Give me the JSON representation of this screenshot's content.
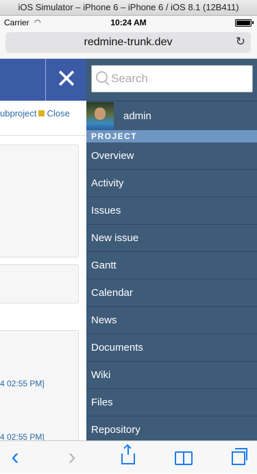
{
  "simulator": {
    "title": "iOS Simulator – iPhone 6 – iPhone 6 / iOS 8.1 (12B411)"
  },
  "status_bar": {
    "carrier": "Carrier",
    "time": "10:24 AM"
  },
  "browser": {
    "url": "redmine-trunk.dev",
    "reload_icon": "reload-icon"
  },
  "page": {
    "close_glyph": "✕",
    "actions_text": "ubproject",
    "close_label": "Close",
    "timestamps": [
      "4 02:55 PM]",
      "4 02:55 PM]"
    ]
  },
  "sidebar": {
    "search": {
      "placeholder": "Search",
      "value": ""
    },
    "user": {
      "name": "admin"
    },
    "section": "PROJECT",
    "items": [
      {
        "label": "Overview"
      },
      {
        "label": "Activity"
      },
      {
        "label": "Issues"
      },
      {
        "label": "New issue"
      },
      {
        "label": "Gantt"
      },
      {
        "label": "Calendar"
      },
      {
        "label": "News"
      },
      {
        "label": "Documents"
      },
      {
        "label": "Wiki"
      },
      {
        "label": "Files"
      },
      {
        "label": "Repository"
      }
    ]
  },
  "toolbar": {
    "back_glyph": "‹",
    "forward_glyph": "›",
    "bookmarks_glyph": "📖"
  },
  "colors": {
    "sidebar": "#3e5b78",
    "section": "#6e96c2",
    "header": "#3b5ba7",
    "link": "#2a6aa3",
    "ios_blue": "#1a7cf0"
  }
}
